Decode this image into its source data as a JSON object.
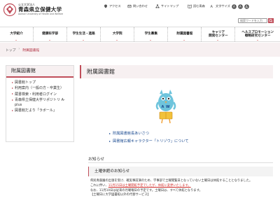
{
  "header": {
    "logo_small": "公立大学法人",
    "logo_main": "青森県立保健大学",
    "logo_en": "Aomori University of Health and Welfare",
    "utility": [
      {
        "label": "アクセス",
        "icon": "map-pin-icon"
      },
      {
        "label": "問い合わせ",
        "icon": "phone-icon"
      },
      {
        "label": "サイトマップ",
        "icon": "sitemap-icon"
      },
      {
        "label": "読む青森",
        "icon": "book-icon"
      },
      {
        "label": "文字サイズ",
        "icon": "text-size-icon"
      }
    ],
    "search_placeholder": "検索ワードを入力"
  },
  "nav": [
    {
      "label": "大学紹介"
    },
    {
      "label": "健康科学部"
    },
    {
      "label": "学生生活・進路"
    },
    {
      "label": "大学院"
    },
    {
      "label": "学生募集"
    },
    {
      "label": "附属図書館"
    },
    {
      "label": "キャリア\n開発センター"
    },
    {
      "label": "ヘルスプロモーション\n戦略研究センター"
    }
  ],
  "breadcrumb": {
    "home": "トップ",
    "separator": "›",
    "current": "附属図書館"
  },
  "sidebar": {
    "title": "附属図書館",
    "items": [
      "図書館トップ",
      "利用案内（一般の方・卒業生）",
      "蔵書検索・利用者ログイン",
      "青森県立保健大学リポジトリ A-plus",
      "図書館だより「ラボール」"
    ]
  },
  "main": {
    "title": "附属図書館",
    "links": [
      "附属図書館長あいさつ",
      "図書館広報キャラクター「トリゾウ」について"
    ],
    "notice_heading": "お知らせ",
    "notice_title": "土曜休館のお知らせ",
    "notice_line1": "県民青森園の出張を受け、確実事前演のため、学事部で土曜閲覧日となっていない土曜日は休館することとなりました。",
    "notice_line2_pre": "これに伴い、",
    "notice_line2_red": "11月15日は土曜開館予定でしたが、休館に変更いたします。",
    "notice_line3": "なお、11月10日は従来の月曜曜日の予定です。土曜日は、すべて休館となります。",
    "notice_line4": "【土曜日に大学図書館以外の代替サービス】"
  },
  "colors": {
    "accent": "#c04e5a",
    "link": "#1a4a90",
    "band": "#f7f0f1",
    "alert": "#d0302d"
  }
}
